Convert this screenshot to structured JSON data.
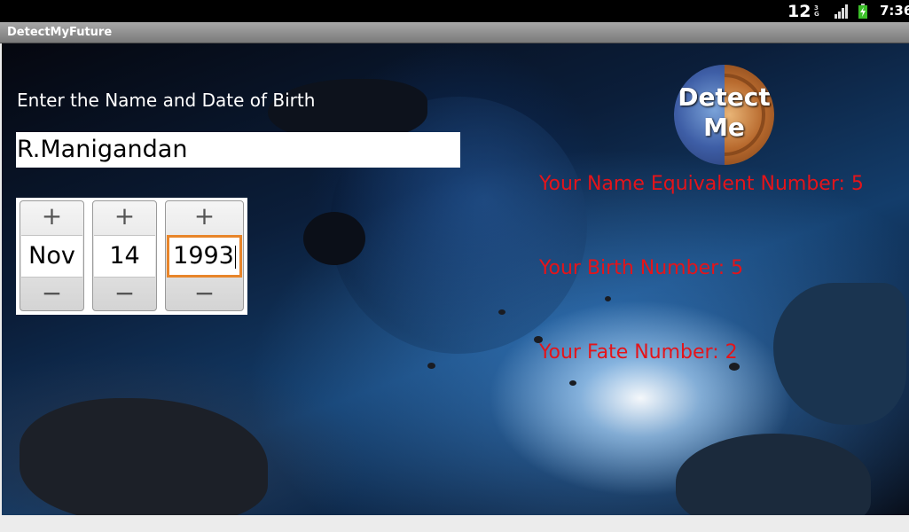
{
  "status_bar": {
    "notification_count": "12",
    "network_type": "3G",
    "time": "7:36",
    "icons": [
      "signal-icon",
      "battery-charging-icon"
    ]
  },
  "app": {
    "title": "DetectMyFuture"
  },
  "form": {
    "prompt": "Enter the Name and Date of Birth",
    "name_value": "R.Manigandan",
    "date": {
      "month": "Nov",
      "day": "14",
      "year": "1993",
      "increment_symbol": "+",
      "decrement_symbol": "−"
    }
  },
  "detect_button": {
    "line1": "Detect",
    "line2": "Me"
  },
  "results": {
    "name_equivalent": "Your Name Equivalent Number: 5",
    "birth_number": "Your Birth Number: 5",
    "fate_number": "Your Fate Number: 2"
  },
  "colors": {
    "result_text": "#e4141a",
    "focus_border": "#e8852a",
    "title_bar": "#8a8a8a"
  }
}
